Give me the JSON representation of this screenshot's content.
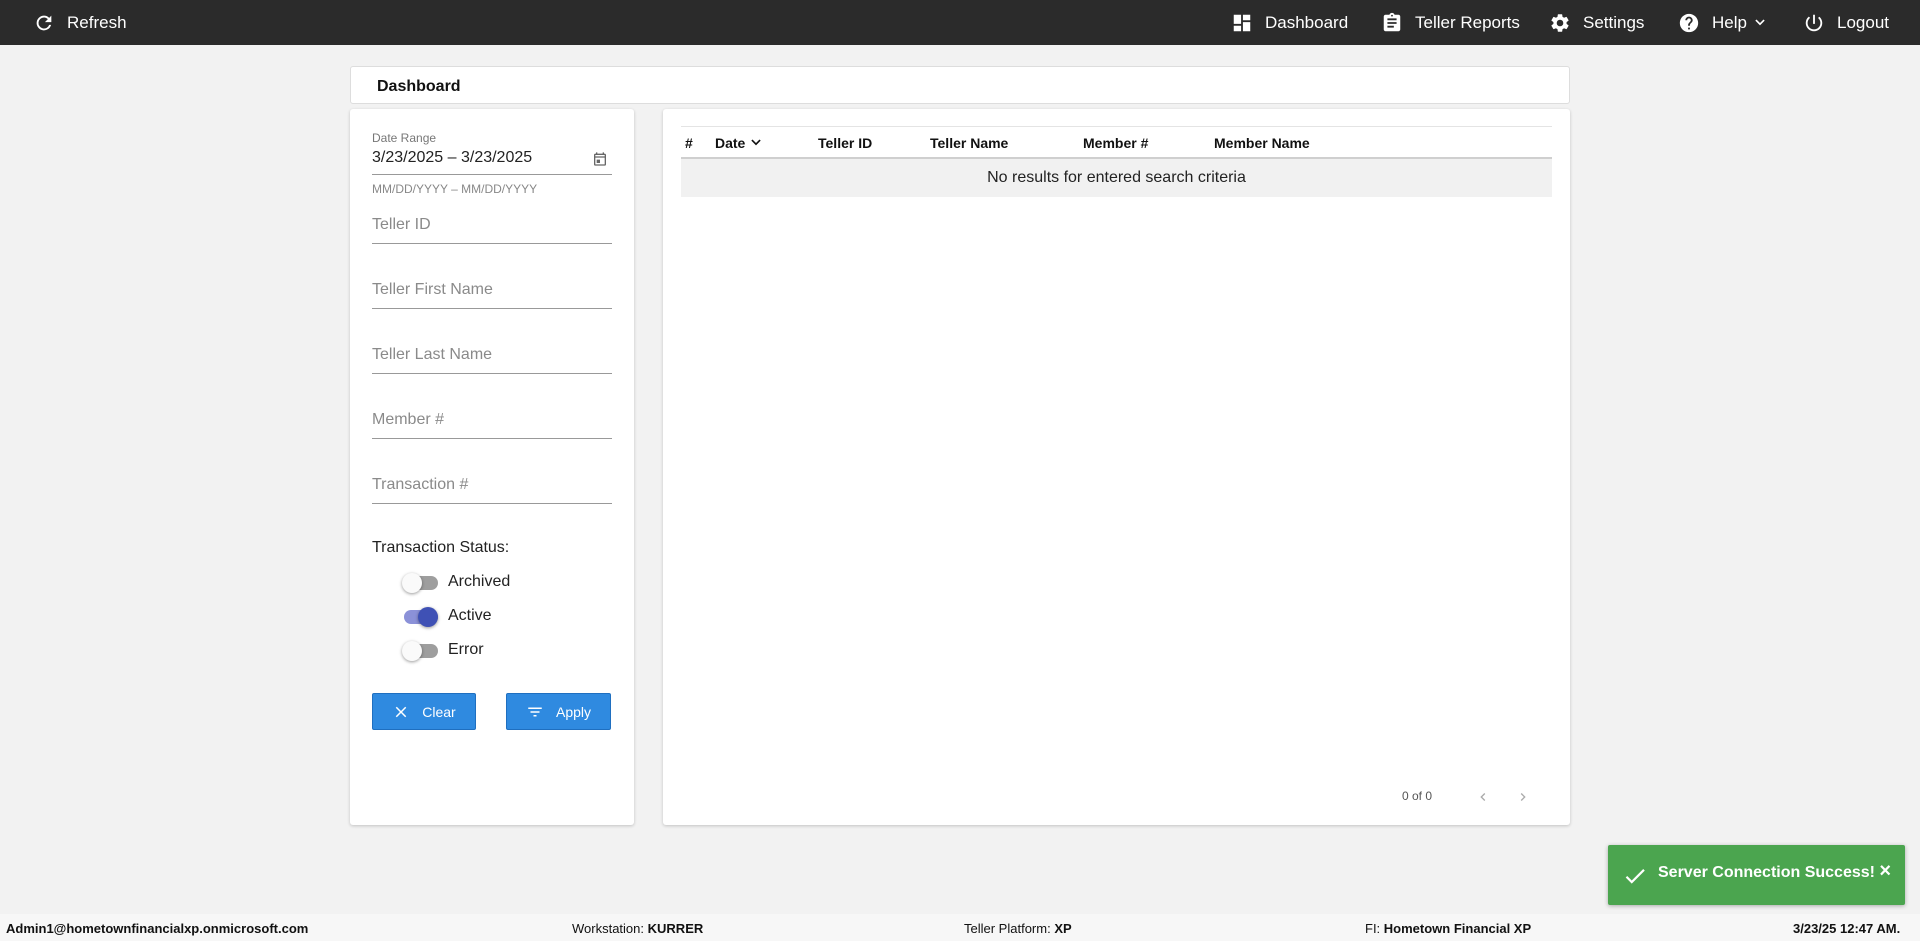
{
  "topbar": {
    "refresh_label": "Refresh",
    "nav": {
      "dashboard": "Dashboard",
      "teller_reports": "Teller Reports",
      "settings": "Settings",
      "help": "Help",
      "logout": "Logout"
    }
  },
  "page": {
    "title": "Dashboard"
  },
  "filters": {
    "date_range_label": "Date Range",
    "date_range_value": "3/23/2025 – 3/23/2025",
    "date_range_hint": "MM/DD/YYYY – MM/DD/YYYY",
    "teller_id_placeholder": "Teller ID",
    "teller_first_name_placeholder": "Teller First Name",
    "teller_last_name_placeholder": "Teller Last Name",
    "member_number_placeholder": "Member #",
    "transaction_number_placeholder": "Transaction #",
    "status_label": "Transaction Status:",
    "statuses": [
      {
        "label": "Archived",
        "on": false
      },
      {
        "label": "Active",
        "on": true
      },
      {
        "label": "Error",
        "on": false
      }
    ],
    "clear_label": "Clear",
    "apply_label": "Apply"
  },
  "table": {
    "columns": [
      "#",
      "Date",
      "Teller ID",
      "Teller Name",
      "Member #",
      "Member Name"
    ],
    "empty_message": "No results for entered search criteria",
    "pager_text": "0 of 0"
  },
  "toast": {
    "message": "Server Connection Success!",
    "close": "×",
    "color": "#4ba54f"
  },
  "footer": {
    "user": "Admin1@hometownfinancialxp.onmicrosoft.com",
    "workstation_label": "Workstation:",
    "workstation_value": "KURRER",
    "platform_label": "Teller Platform:",
    "platform_value": "XP",
    "fi_label": "FI:",
    "fi_value": "Hometown Financial XP",
    "datetime": "3/23/25 12:47 AM."
  },
  "colors": {
    "topbar": "#2b2b2b",
    "button": "#2f8ae0",
    "toggle_active": "#3f51b5"
  }
}
